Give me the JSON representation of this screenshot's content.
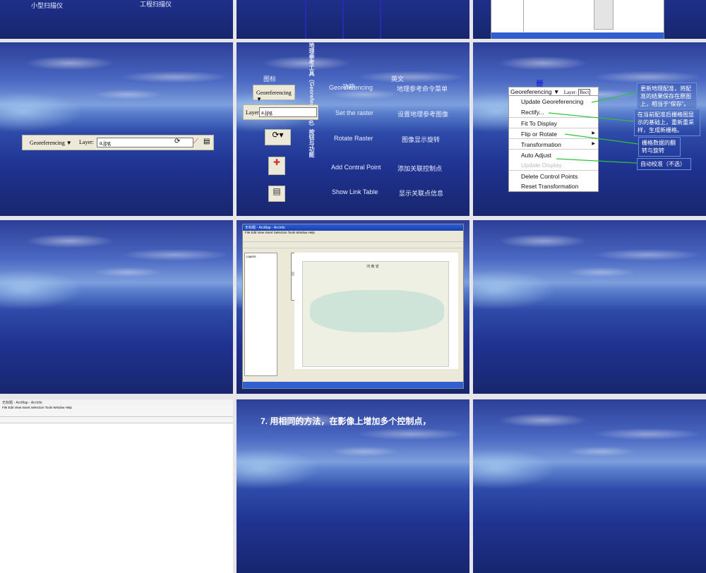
{
  "slides": [
    {
      "id": 1,
      "labels": [
        "小型扫描仪",
        "工程扫描仪"
      ]
    },
    {
      "id": 2
    },
    {
      "id": 3,
      "desc": "ArcMap screenshot"
    },
    {
      "id": 4,
      "toolbar": {
        "georef": "Georeferencing ▼",
        "layer_label": "Layer:",
        "layer_value": "a.jpg"
      }
    },
    {
      "id": 5,
      "vertical_title": "地理参考工具（Georeferencing）按钮与功能",
      "headers": {
        "icon": "图标",
        "function": "功能",
        "english": "英文"
      },
      "rows": [
        {
          "en": "Georeferencing",
          "cn": "地理参考命令菜单"
        },
        {
          "en": "Set the raster",
          "cn": "设置地理参考图像"
        },
        {
          "en": "Rotate Raster",
          "cn": "图像显示旋转"
        },
        {
          "en": "Add Contral Point",
          "cn": "添加关联控制点"
        },
        {
          "en": "Show Link Table",
          "cn": "显示关联点信息"
        }
      ],
      "georef_btn": "Georeferencing ▼",
      "layer_label": "Layer:",
      "layer_value": "a.jpg"
    },
    {
      "id": 6,
      "georef": "Georeferencing ▼",
      "layer_label": "Layer:",
      "layer_value": "Rect",
      "menu": [
        "Update Georeferencing",
        "Rectify...",
        "Fit To Display",
        "Flip or Rotate",
        "Transformation",
        "Auto Adjust",
        "Update Display",
        "Delete Control Points",
        "Reset Transformation"
      ],
      "notes": [
        "更新地理配准，将配准的结果保存在原图上，相当于“保存”。",
        "在当前配准后栅格图显示的基础上，重新重采样，生成新栅格。",
        "栅格数据的翻转与旋转",
        "自动校准（不选）"
      ]
    },
    {
      "id": 7
    },
    {
      "id": 8,
      "window_title": "无标题 - ArcMap - ArcInfo",
      "menubar": "File Edit View Insert Selection Tools Window Help",
      "map_title": "河 南 省",
      "layers": "Layers"
    },
    {
      "id": 9
    },
    {
      "id": 10,
      "window_title": "无标题 - ArcMap - ArcInfo",
      "menubar": "File Edit View Insert Selection Tools Window Help"
    },
    {
      "id": 11,
      "text": "7. 用相同的方法，在影像上增加多个控制点，"
    },
    {
      "id": 12
    }
  ]
}
